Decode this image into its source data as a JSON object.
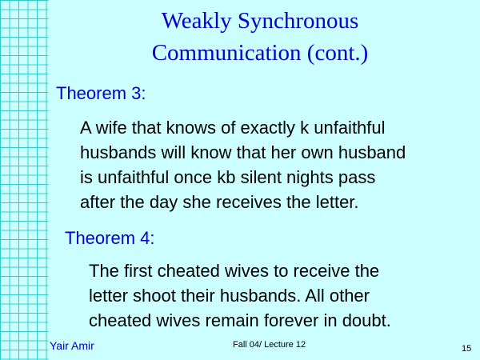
{
  "title": {
    "line1": "Weakly Synchronous",
    "line2": "Communication (cont.)"
  },
  "theorem3": {
    "label": "Theorem 3:",
    "text": "A wife that knows of exactly  k unfaithful\nhusbands will know that her own husband\nis unfaithful once kb silent nights pass\nafter the day she receives the letter."
  },
  "theorem4": {
    "label": "Theorem 4:",
    "text": "The first cheated wives to receive the\nletter shoot their husbands. All other\ncheated wives remain forever in doubt."
  },
  "footer": {
    "author": "Yair Amir",
    "course": "Fall 04/ Lecture 12",
    "page_number": "15"
  },
  "colors": {
    "background": "#ccffff",
    "grid_line": "#33cccc",
    "heading": "#0000cc",
    "body_text": "#000000"
  }
}
